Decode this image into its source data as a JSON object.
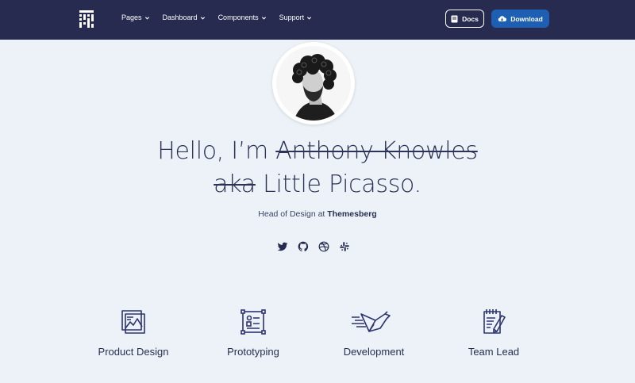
{
  "nav": {
    "items": [
      {
        "label": "Pages"
      },
      {
        "label": "Dashboard"
      },
      {
        "label": "Components"
      },
      {
        "label": "Support"
      }
    ],
    "docs_label": "Docs",
    "download_label": "Download"
  },
  "hero": {
    "greeting": "Hello, I’m",
    "struck_name": "Anthony Knowles",
    "struck_aka": "aka",
    "nickname": "Little Picasso.",
    "role": "Head of Design at",
    "company": "Themesberg"
  },
  "socials": [
    {
      "icon": "twitter-icon"
    },
    {
      "icon": "github-icon"
    },
    {
      "icon": "dribbble-icon"
    },
    {
      "icon": "slack-icon"
    }
  ],
  "features": [
    {
      "label": "Product Design",
      "icon": "product-design-icon"
    },
    {
      "label": "Prototyping",
      "icon": "prototyping-icon"
    },
    {
      "label": "Development",
      "icon": "development-icon"
    },
    {
      "label": "Team Lead",
      "icon": "team-lead-icon"
    }
  ],
  "colors": {
    "navbar": "#262b4f",
    "background": "#ecf2f7",
    "accent": "#1d5fb3",
    "text": "#262f50"
  }
}
